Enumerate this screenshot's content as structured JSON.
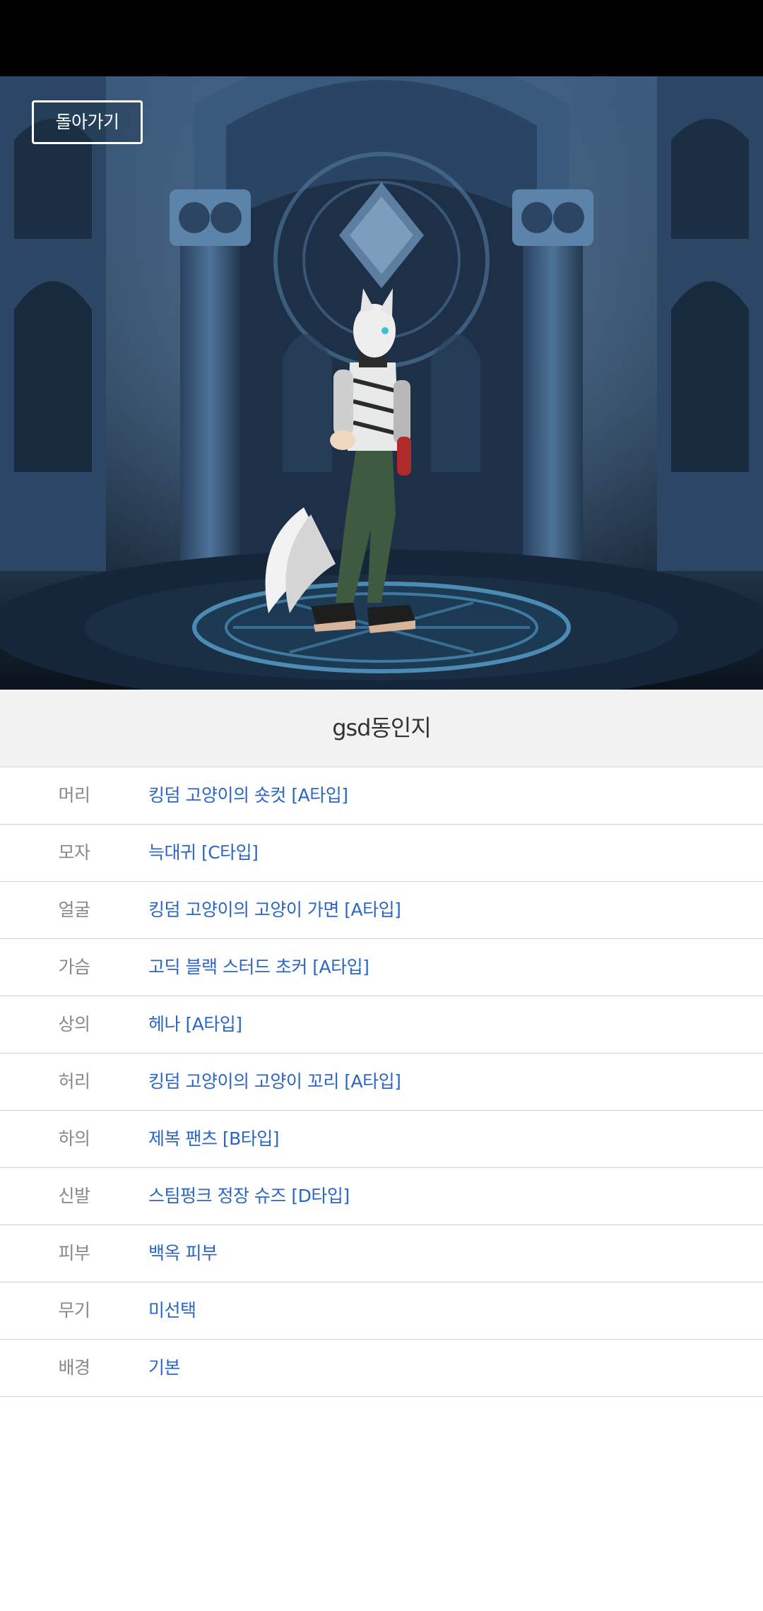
{
  "hero": {
    "back_label": "돌아가기"
  },
  "character": {
    "name": "gsd동인지"
  },
  "equipment": [
    {
      "slot": "머리",
      "item": "킹덤 고양이의 숏컷 [A타입]"
    },
    {
      "slot": "모자",
      "item": "늑대귀 [C타입]"
    },
    {
      "slot": "얼굴",
      "item": "킹덤 고양이의 고양이 가면 [A타입]"
    },
    {
      "slot": "가슴",
      "item": "고딕 블랙 스터드 초커 [A타입]"
    },
    {
      "slot": "상의",
      "item": "헤나 [A타입]"
    },
    {
      "slot": "허리",
      "item": "킹덤 고양이의 고양이 꼬리 [A타입]"
    },
    {
      "slot": "하의",
      "item": "제복 팬츠 [B타입]"
    },
    {
      "slot": "신발",
      "item": "스팀펑크 정장 슈즈 [D타입]"
    },
    {
      "slot": "피부",
      "item": "백옥 피부"
    },
    {
      "slot": "무기",
      "item": "미선택"
    },
    {
      "slot": "배경",
      "item": "기본"
    }
  ],
  "colors": {
    "item_link": "#2b66c4",
    "slot_label": "#888888",
    "title_bg": "#f2f2f2",
    "hero_bg": "#22364c"
  }
}
